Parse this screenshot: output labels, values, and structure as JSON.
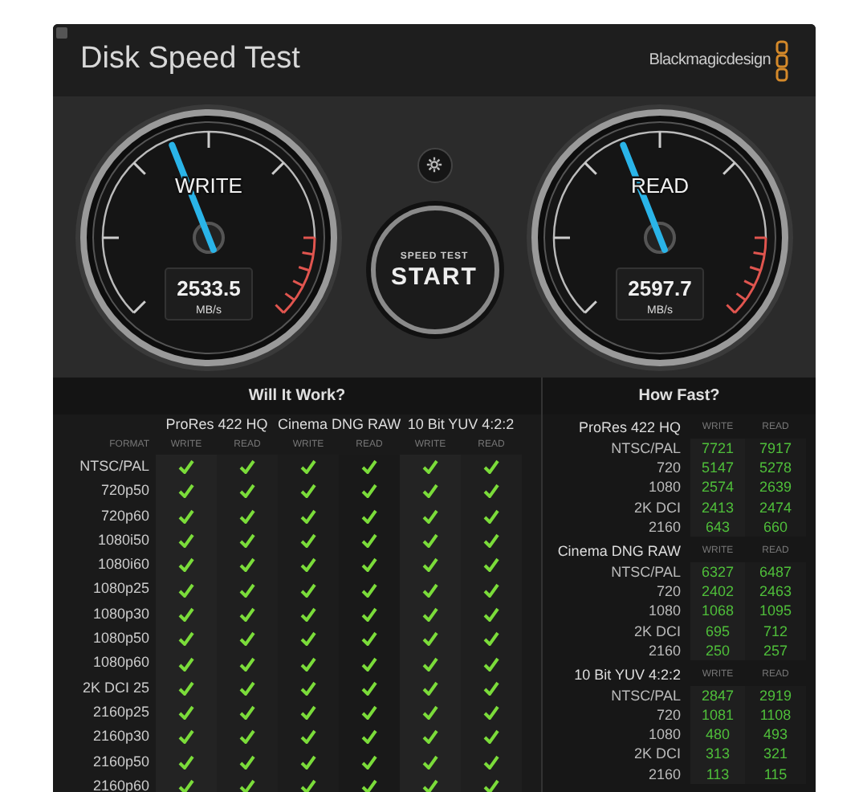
{
  "window": {
    "title": "Disk Speed Test",
    "brand": "Blackmagicdesign"
  },
  "gauges": [
    {
      "label": "WRITE",
      "reading": "2533.5",
      "unit": "MB/s"
    },
    {
      "label": "READ",
      "reading": "2597.7",
      "unit": "MB/s"
    }
  ],
  "start_button": {
    "caption": "SPEED TEST",
    "label": "START"
  },
  "will_it_work": {
    "title": "Will It Work?",
    "format_header": "FORMAT",
    "codecs": [
      {
        "name": "ProRes 422 HQ",
        "columns": [
          "WRITE",
          "READ"
        ]
      },
      {
        "name": "Cinema DNG RAW",
        "columns": [
          "WRITE",
          "READ"
        ]
      },
      {
        "name": "10 Bit YUV 4:2:2",
        "columns": [
          "WRITE",
          "READ"
        ]
      }
    ],
    "rows": [
      {
        "format": "NTSC/PAL",
        "checks": [
          true,
          true,
          true,
          true,
          true,
          true
        ]
      },
      {
        "format": "720p50",
        "checks": [
          true,
          true,
          true,
          true,
          true,
          true
        ]
      },
      {
        "format": "720p60",
        "checks": [
          true,
          true,
          true,
          true,
          true,
          true
        ]
      },
      {
        "format": "1080i50",
        "checks": [
          true,
          true,
          true,
          true,
          true,
          true
        ]
      },
      {
        "format": "1080i60",
        "checks": [
          true,
          true,
          true,
          true,
          true,
          true
        ]
      },
      {
        "format": "1080p25",
        "checks": [
          true,
          true,
          true,
          true,
          true,
          true
        ]
      },
      {
        "format": "1080p30",
        "checks": [
          true,
          true,
          true,
          true,
          true,
          true
        ]
      },
      {
        "format": "1080p50",
        "checks": [
          true,
          true,
          true,
          true,
          true,
          true
        ]
      },
      {
        "format": "1080p60",
        "checks": [
          true,
          true,
          true,
          true,
          true,
          true
        ]
      },
      {
        "format": "2K DCI 25",
        "checks": [
          true,
          true,
          true,
          true,
          true,
          true
        ]
      },
      {
        "format": "2160p25",
        "checks": [
          true,
          true,
          true,
          true,
          true,
          true
        ]
      },
      {
        "format": "2160p30",
        "checks": [
          true,
          true,
          true,
          true,
          true,
          true
        ]
      },
      {
        "format": "2160p50",
        "checks": [
          true,
          true,
          true,
          true,
          true,
          true
        ]
      },
      {
        "format": "2160p60",
        "checks": [
          true,
          true,
          true,
          true,
          true,
          true
        ]
      }
    ]
  },
  "how_fast": {
    "title": "How Fast?",
    "groups": [
      {
        "name": "ProRes 422 HQ",
        "write_header": "WRITE",
        "read_header": "READ",
        "rows": [
          {
            "resolution": "NTSC/PAL",
            "write": "7721",
            "read": "7917"
          },
          {
            "resolution": "720",
            "write": "5147",
            "read": "5278"
          },
          {
            "resolution": "1080",
            "write": "2574",
            "read": "2639"
          },
          {
            "resolution": "2K DCI",
            "write": "2413",
            "read": "2474"
          },
          {
            "resolution": "2160",
            "write": "643",
            "read": "660"
          }
        ]
      },
      {
        "name": "Cinema DNG RAW",
        "write_header": "WRITE",
        "read_header": "READ",
        "rows": [
          {
            "resolution": "NTSC/PAL",
            "write": "6327",
            "read": "6487"
          },
          {
            "resolution": "720",
            "write": "2402",
            "read": "2463"
          },
          {
            "resolution": "1080",
            "write": "1068",
            "read": "1095"
          },
          {
            "resolution": "2K DCI",
            "write": "695",
            "read": "712"
          },
          {
            "resolution": "2160",
            "write": "250",
            "read": "257"
          }
        ]
      },
      {
        "name": "10 Bit YUV 4:2:2",
        "write_header": "WRITE",
        "read_header": "READ",
        "rows": [
          {
            "resolution": "NTSC/PAL",
            "write": "2847",
            "read": "2919"
          },
          {
            "resolution": "720",
            "write": "1081",
            "read": "1108"
          },
          {
            "resolution": "1080",
            "write": "480",
            "read": "493"
          },
          {
            "resolution": "2K DCI",
            "write": "313",
            "read": "321"
          },
          {
            "resolution": "2160",
            "write": "113",
            "read": "115"
          }
        ]
      }
    ]
  }
}
